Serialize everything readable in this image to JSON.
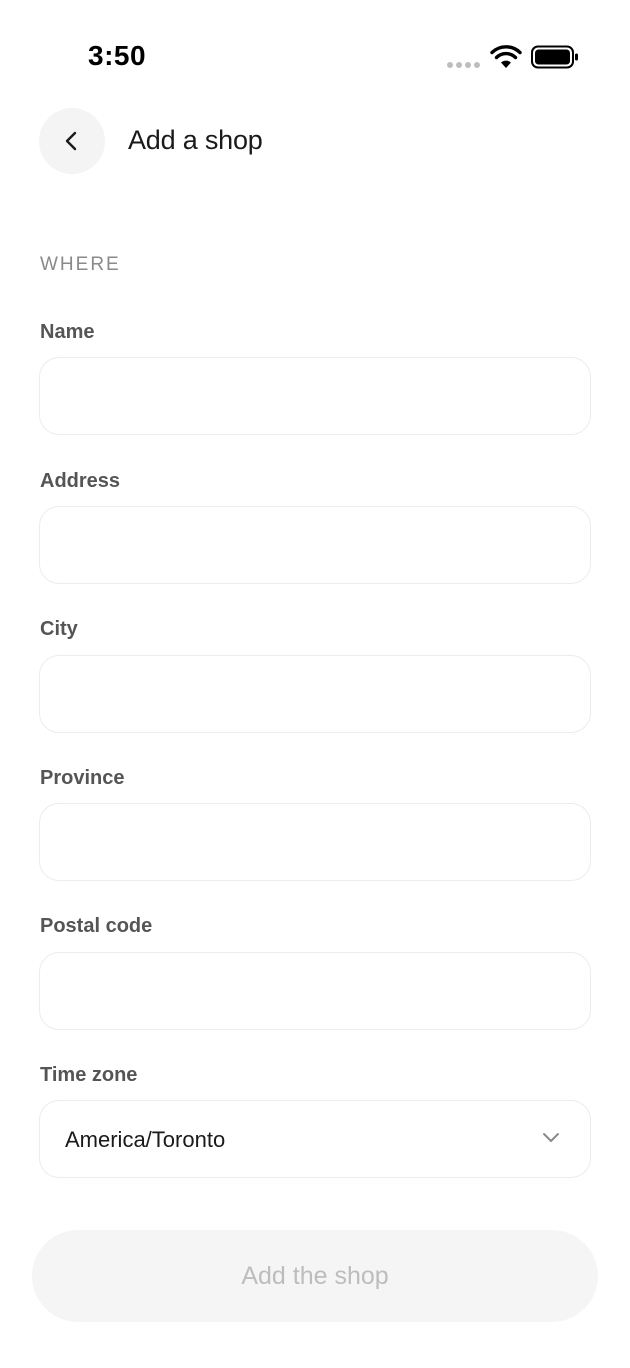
{
  "status_bar": {
    "time": "3:50"
  },
  "header": {
    "title": "Add a shop"
  },
  "section": {
    "label": "WHERE"
  },
  "fields": {
    "name": {
      "label": "Name",
      "value": ""
    },
    "address": {
      "label": "Address",
      "value": ""
    },
    "city": {
      "label": "City",
      "value": ""
    },
    "province": {
      "label": "Province",
      "value": ""
    },
    "postal_code": {
      "label": "Postal code",
      "value": ""
    },
    "time_zone": {
      "label": "Time zone",
      "value": "America/Toronto"
    }
  },
  "submit": {
    "label": "Add the shop"
  },
  "icons": {
    "back": "chevron-left-icon",
    "dropdown": "chevron-down-icon"
  },
  "colors": {
    "disabled_text": "#bdbdbd",
    "border": "#ececec",
    "muted": "#8a8a8a"
  }
}
